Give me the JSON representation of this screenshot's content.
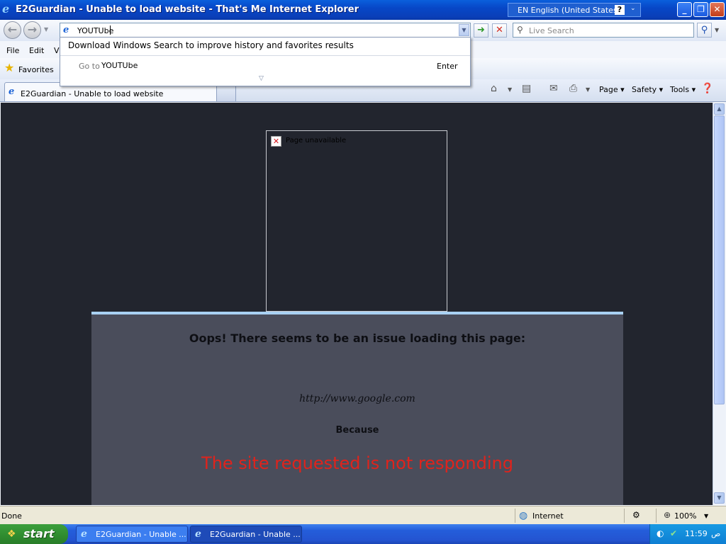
{
  "window": {
    "title": "E2Guardian - Unable to load website - That's Me Internet Explorer",
    "language": "EN English (United States)",
    "help_glyph": "?"
  },
  "toolbar": {
    "address_value": "YOUTUbe",
    "search_placeholder": "Live Search"
  },
  "menu": {
    "items": [
      "File",
      "Edit",
      "Vi"
    ]
  },
  "favorites": {
    "label": "Favorites"
  },
  "tab": {
    "label": "E2Guardian - Unable to load website"
  },
  "command_bar": {
    "page": "Page",
    "safety": "Safety",
    "tools": "Tools"
  },
  "suggestion": {
    "download_text": "Download Windows Search to improve history and favorites results",
    "goto_label": "Go to",
    "goto_value": "YOUTUbe",
    "enter_label": "Enter"
  },
  "page": {
    "frame_text": "Page unavailable",
    "heading": "Oops! There seems to be an issue loading this page:",
    "url": "http://www.google.com",
    "because": "Because",
    "reason": "The site requested is not responding",
    "reason_color": "#e0231c"
  },
  "status": {
    "left": "Done",
    "zone": "Internet",
    "zoom": "100%"
  },
  "taskbar": {
    "start_label": "start",
    "tasks": [
      "E2Guardian - Unable ...",
      "E2Guardian - Unable ..."
    ],
    "clock": "11:59",
    "clock_suffix": "ص"
  }
}
